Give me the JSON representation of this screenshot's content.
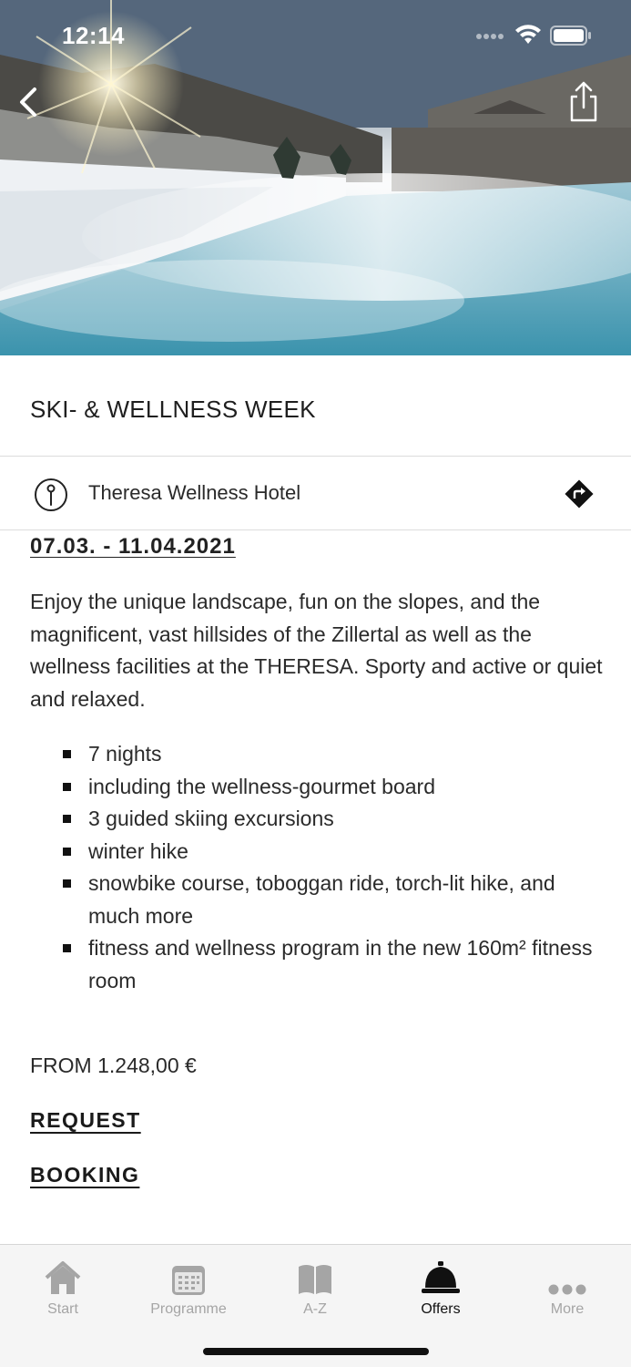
{
  "status_bar": {
    "time": "12:14"
  },
  "offer": {
    "title": "SKI- & WELLNESS WEEK",
    "location": "Theresa Wellness Hotel",
    "date_range": "07.03. - 11.04.2021",
    "description": "Enjoy the unique landscape, fun on the slopes, and the magnificent, vast hillsides of the Zillertal as well as the wellness facilities at the THERESA. Sporty and active or quiet and relaxed.",
    "features": [
      "7 nights",
      "including the wellness-gourmet board",
      "3 guided skiing excursions",
      "winter hike",
      "snowbike course, toboggan ride, torch-lit hike, and much more",
      "fitness and wellness program in the new 160m² fitness room"
    ],
    "price": "FROM 1.248,00 €",
    "request_label": "REQUEST",
    "booking_label": "BOOKING"
  },
  "tabbar": {
    "tabs": [
      {
        "label": "Start",
        "icon": "home-icon",
        "active": false
      },
      {
        "label": "Programme",
        "icon": "calendar-icon",
        "active": false
      },
      {
        "label": "A-Z",
        "icon": "book-icon",
        "active": false
      },
      {
        "label": "Offers",
        "icon": "service-bell-icon",
        "active": true
      },
      {
        "label": "More",
        "icon": "more-dots-icon",
        "active": false
      }
    ]
  },
  "colors": {
    "accent": "#111111",
    "inactive_tab": "#a5a5a5",
    "tabbar_bg": "#f5f5f5"
  }
}
